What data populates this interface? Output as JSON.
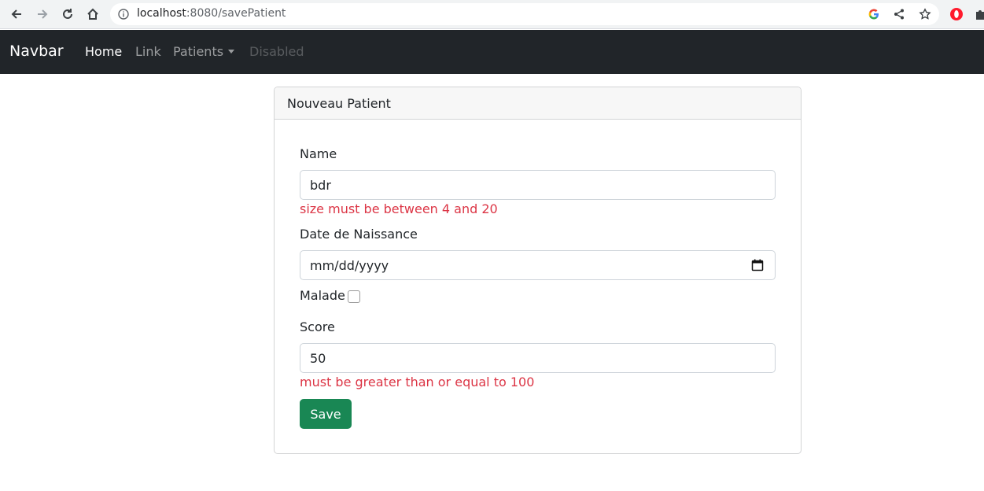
{
  "browser": {
    "url_host": "localhost",
    "url_path": ":8080/savePatient",
    "icons": [
      "back-icon",
      "forward-icon",
      "reload-icon",
      "home-icon",
      "info-icon",
      "google-icon",
      "share-icon",
      "star-icon",
      "opera-icon",
      "extensions-icon"
    ]
  },
  "navbar": {
    "brand": "Navbar",
    "links": [
      {
        "label": "Home",
        "state": "active"
      },
      {
        "label": "Link",
        "state": "normal"
      },
      {
        "label": "Patients",
        "state": "dropdown"
      },
      {
        "label": "Disabled",
        "state": "disabled"
      }
    ]
  },
  "card": {
    "title": "Nouveau Patient",
    "name": {
      "label": "Name",
      "value": "bdr",
      "error": "size must be between 4 and 20"
    },
    "birthdate": {
      "label": "Date de Naissance",
      "value": "mm/dd/yyyy"
    },
    "malade": {
      "label": "Malade",
      "checked": false
    },
    "score": {
      "label": "Score",
      "value": "50",
      "error": "must be greater than or equal to 100"
    },
    "save_label": "Save"
  },
  "colors": {
    "navbar_bg": "#212529",
    "error": "#dc3545",
    "save_button": "#198754"
  }
}
